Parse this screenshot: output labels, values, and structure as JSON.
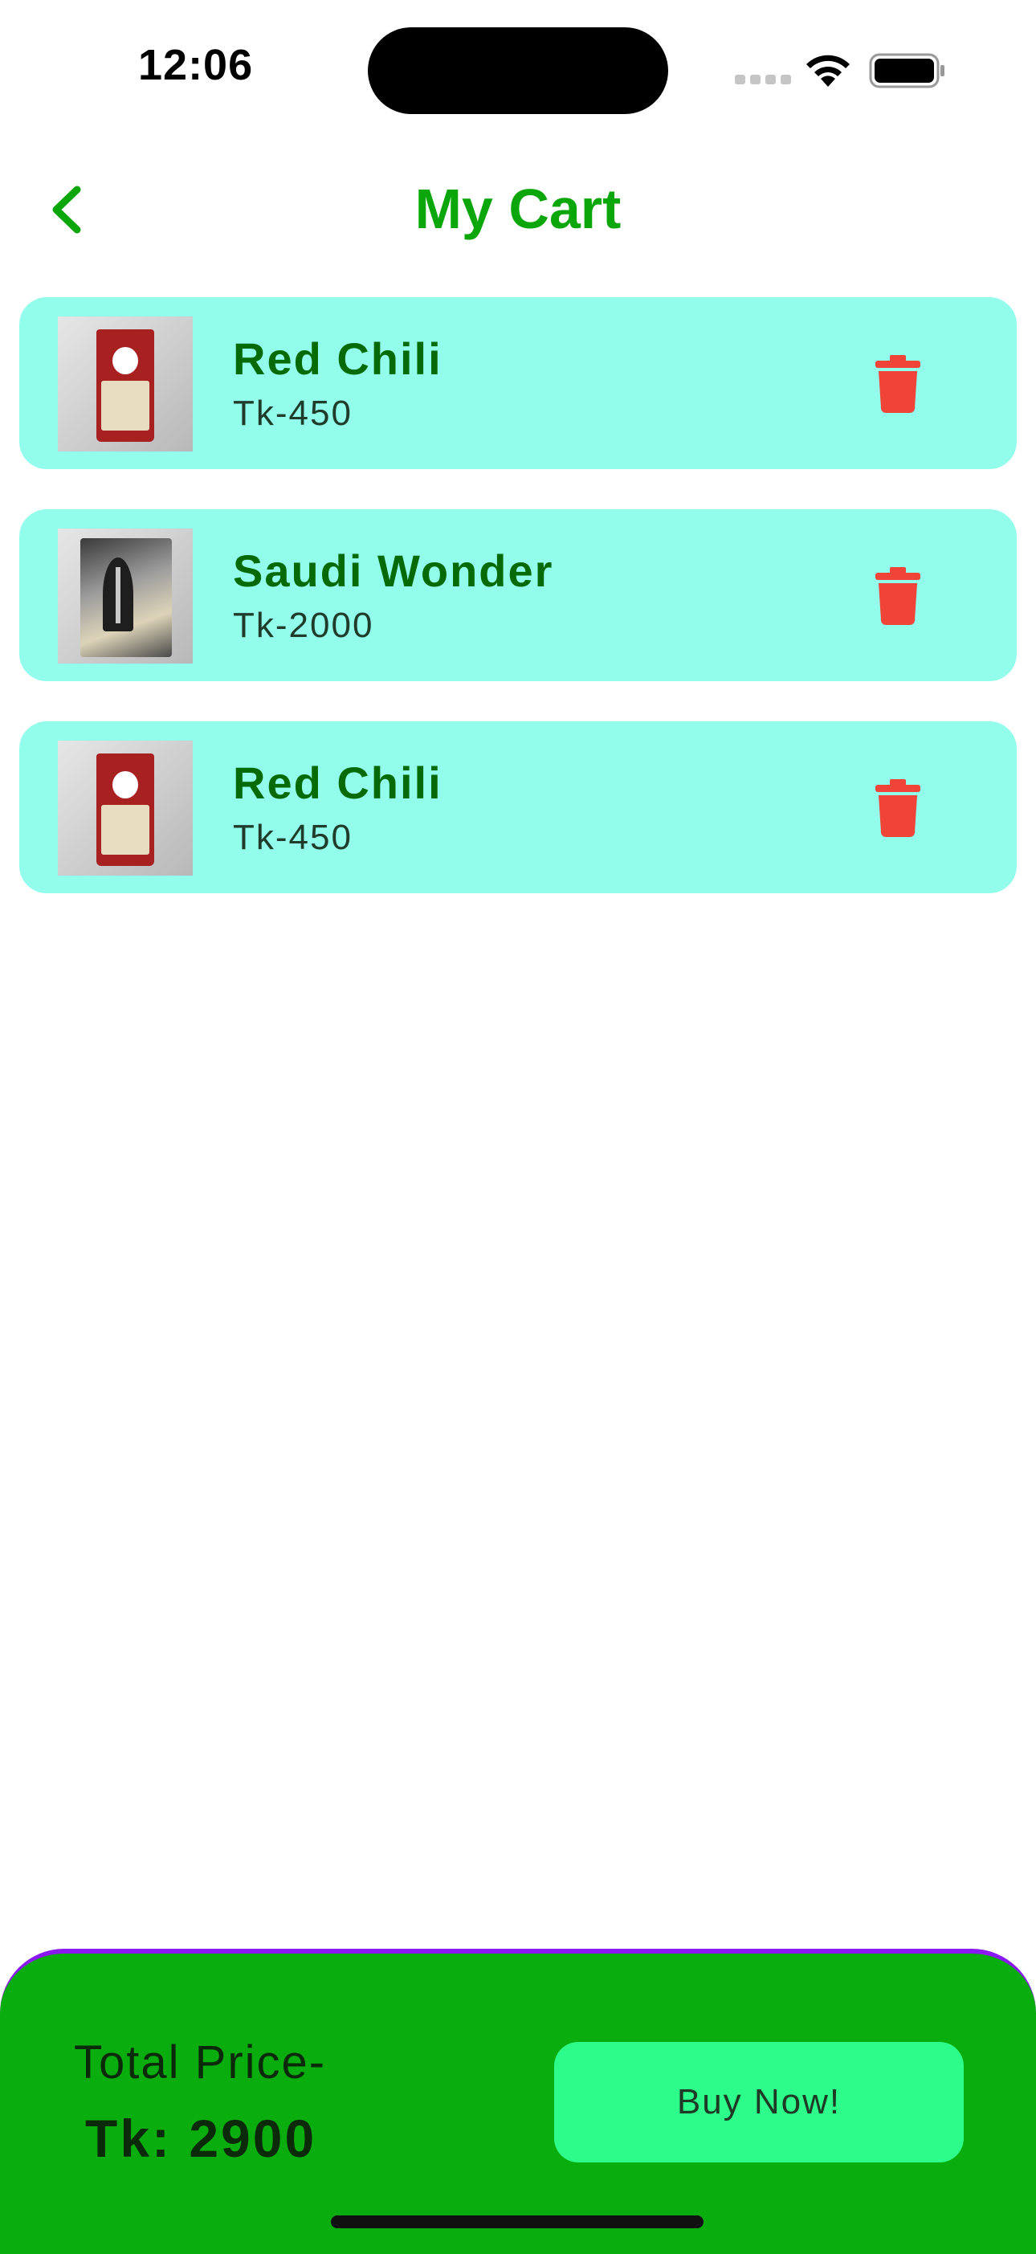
{
  "status_bar": {
    "time": "12:06"
  },
  "header": {
    "title": "My Cart",
    "back_icon": "chevron-left-icon"
  },
  "cart": {
    "items": [
      {
        "name": "Red Chili",
        "price": "Tk-450",
        "image": "red-rice-pack",
        "delete_icon": "trash-icon"
      },
      {
        "name": "Saudi Wonder",
        "price": "Tk-2000",
        "image": "silver-rice-pack",
        "delete_icon": "trash-icon"
      },
      {
        "name": "Red Chili",
        "price": "Tk-450",
        "image": "red-rice-pack",
        "delete_icon": "trash-icon"
      }
    ]
  },
  "footer": {
    "total_label": "Total Price-",
    "total_value": "Tk: 2900",
    "buy_label": "Buy Now!"
  },
  "colors": {
    "accent_green": "#0aa60a",
    "card_bg": "#93fdec",
    "delete_red": "#f04438",
    "footer_bg": "#09ad0d",
    "footer_border": "#8a18f0",
    "buy_button": "#2efc8a"
  }
}
